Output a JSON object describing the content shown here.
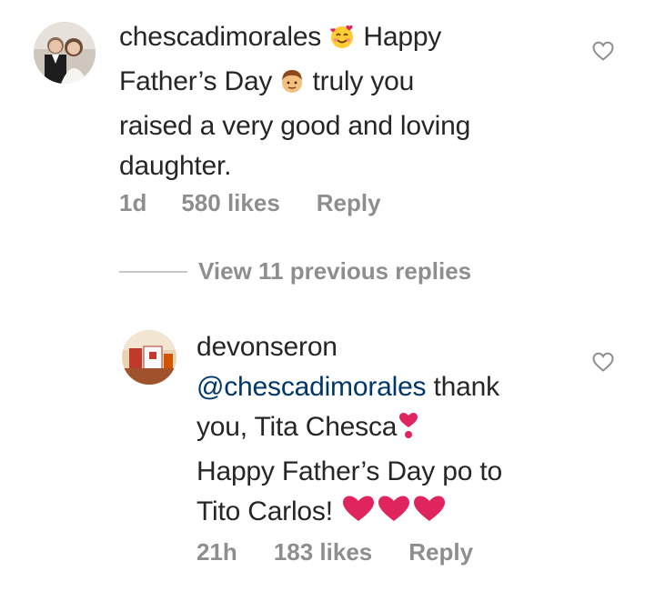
{
  "comments": [
    {
      "username": "chescadimorales",
      "text_parts": {
        "after_user_emoji": "smiling-face-with-hearts",
        "part1": "Happy",
        "part2": "Father’s Day",
        "emoji2": "boy-face",
        "part3": "truly you",
        "part4": "raised a very good and loving",
        "part5": "daughter."
      },
      "age": "1d",
      "likes": "580 likes",
      "reply_label": "Reply"
    },
    {
      "username": "devonseron",
      "mention": "@chescadimorales",
      "text_parts": {
        "part1": "thank",
        "part2": "you, Tita Chesca",
        "emoji1": "heavy-heart-exclamation",
        "part3": "Happy Father’s Day po to",
        "part4": "Tito Carlos!",
        "emoji2": "three-red-hearts"
      },
      "age": "21h",
      "likes": "183 likes",
      "reply_label": "Reply"
    }
  ],
  "view_replies_label": "View 11 previous replies",
  "colors": {
    "text": "#262626",
    "meta": "#8e8e8e",
    "mention": "#00376b",
    "heart_red": "#e0245e",
    "divider": "#c7c7c7"
  }
}
